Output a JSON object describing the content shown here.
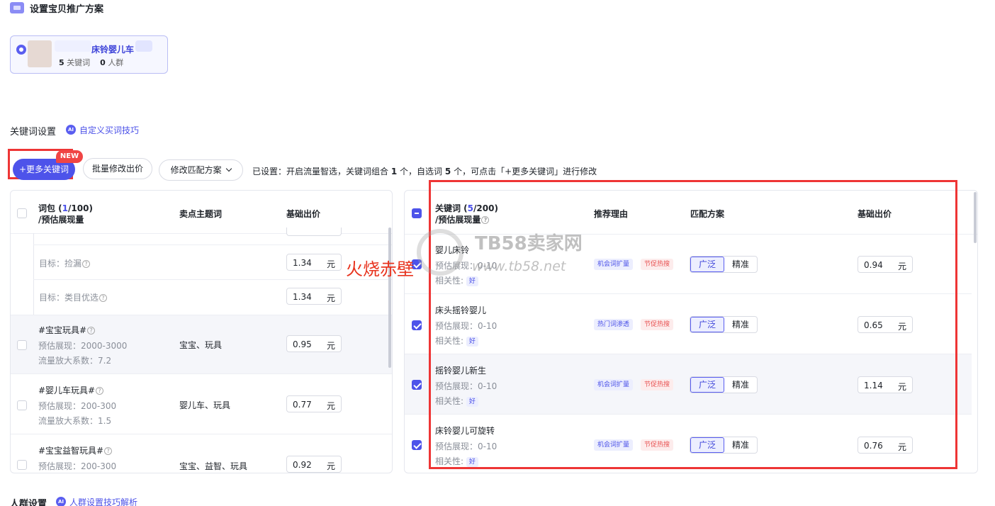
{
  "header": {
    "title": "设置宝贝推广方案",
    "icon": "coupon-icon"
  },
  "product": {
    "name": "床铃婴儿车",
    "keyword_count": "5",
    "keyword_label": "关键词",
    "crowd_count": "0",
    "crowd_label": "人群"
  },
  "keyword_section": {
    "title": "关键词设置",
    "ai": "AI",
    "link": "自定义买词技巧"
  },
  "toolbar": {
    "more_keywords": "+更多关键词",
    "new_badge": "NEW",
    "batch_price": "批量修改出价",
    "match_plan": "修改匹配方案",
    "hint": {
      "prefix": "已设置：开启流量智选，关键词组合",
      "combo_count": "1",
      "mid": "个，自选词",
      "self_count": "5",
      "suffix": "个，可点击「+更多关键词」进行修改"
    }
  },
  "left_table": {
    "col_pack": "词包 (",
    "pack_selected": "1",
    "pack_total": "/100)",
    "col_pack_sub": "/预估展现量",
    "col_theme": "卖点主题词",
    "col_price": "基础出价",
    "goal_rows": [
      {
        "label": "目标：捡漏",
        "price": "1.34",
        "unit": "元"
      },
      {
        "label": "目标：类目优选",
        "price": "1.34",
        "unit": "元"
      }
    ],
    "packs": [
      {
        "name": "#宝宝玩具#",
        "impr": "预估展现：2000-3000",
        "factor": "流量放大系数：7.2",
        "theme": "宝宝、玩具",
        "price": "0.95",
        "unit": "元"
      },
      {
        "name": "#婴儿车玩具#",
        "impr": "预估展现：200-300",
        "factor": "流量放大系数：1.5",
        "theme": "婴儿车、玩具",
        "price": "0.77",
        "unit": "元"
      },
      {
        "name": "#宝宝益智玩具#",
        "impr": "预估展现：200-300",
        "factor": "",
        "theme": "宝宝、益智、玩具",
        "price": "0.92",
        "unit": "元"
      }
    ]
  },
  "right_table": {
    "col_kw": "关键词 (",
    "kw_selected": "5",
    "kw_total": "/200)",
    "col_kw_sub": "/预估展现量",
    "col_reason": "推荐理由",
    "col_match": "匹配方案",
    "col_price": "基础出价",
    "rows": [
      {
        "keyword": "婴儿床铃",
        "impr": "预估展现：0-10",
        "rel_label": "相关性:",
        "rel": "好",
        "tag1": "机会词扩量",
        "tag2": "节促热搜",
        "broad": "广泛",
        "exact": "精准",
        "price": "0.94",
        "unit": "元",
        "checked": true
      },
      {
        "keyword": "床头摇铃婴儿",
        "impr": "预估展现：0-10",
        "rel_label": "相关性:",
        "rel": "好",
        "tag1": "热门词渗透",
        "tag2": "节促热搜",
        "broad": "广泛",
        "exact": "精准",
        "price": "0.65",
        "unit": "元",
        "checked": true
      },
      {
        "keyword": "摇铃婴儿新生",
        "impr": "预估展现：0-10",
        "rel_label": "相关性:",
        "rel": "好",
        "tag1": "机会词扩量",
        "tag2": "节促热搜",
        "broad": "广泛",
        "exact": "精准",
        "price": "1.14",
        "unit": "元",
        "checked": true
      },
      {
        "keyword": "床铃婴儿可旋转",
        "impr": "预估展现：0-10",
        "rel_label": "相关性:",
        "rel": "好",
        "tag1": "机会词扩量",
        "tag2": "节促热搜",
        "broad": "广泛",
        "exact": "精准",
        "price": "0.76",
        "unit": "元",
        "checked": true
      }
    ]
  },
  "watermark": {
    "brand": "TB58卖家网",
    "url": "www.tb58.net",
    "overlay": "火烧赤壁"
  },
  "crowd_section": {
    "title": "人群设置",
    "ai": "AI",
    "link": "人群设置技巧解析"
  },
  "colors": {
    "accent": "#4d53ea",
    "annotation_red": "#ee3535"
  }
}
